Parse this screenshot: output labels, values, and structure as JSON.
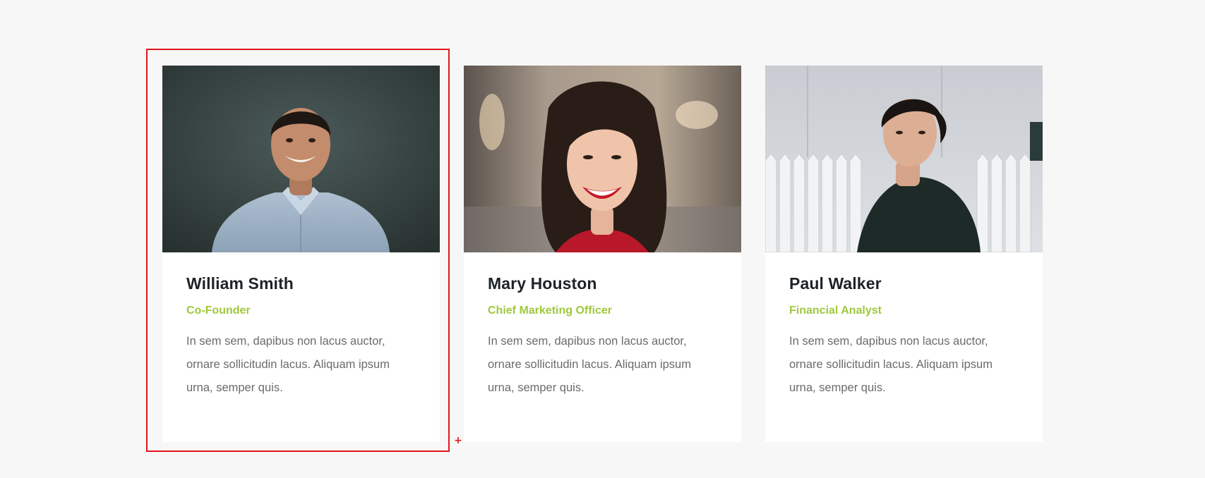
{
  "colors": {
    "background": "#f7f7f7",
    "card": "#ffffff",
    "name": "#1d2327",
    "role_accent": "#9fc83c",
    "bio_text": "#6b6b6b",
    "selection": "#e0161b"
  },
  "team": [
    {
      "name": "William Smith",
      "role": "Co-Founder",
      "bio": "In sem sem, dapibus non lacus auctor, ornare sollicitudin lacus. Aliquam ipsum urna, semper quis.",
      "photo_alt": "Smiling man in light blue shirt"
    },
    {
      "name": "Mary Houston",
      "role": "Chief Marketing Officer",
      "bio": "In sem sem, dapibus non lacus auctor, ornare sollicitudin lacus. Aliquam ipsum urna, semper quis.",
      "photo_alt": "Laughing woman with red lipstick"
    },
    {
      "name": "Paul Walker",
      "role": "Financial Analyst",
      "bio": "In sem sem, dapibus non lacus auctor, ornare sollicitudin lacus. Aliquam ipsum urna, semper quis.",
      "photo_alt": "Young man in dark jacket by white fence"
    }
  ],
  "editor": {
    "selected_card": "team-card-william-smith",
    "handle_glyph": "+",
    "handle_icon": "plus-icon"
  }
}
